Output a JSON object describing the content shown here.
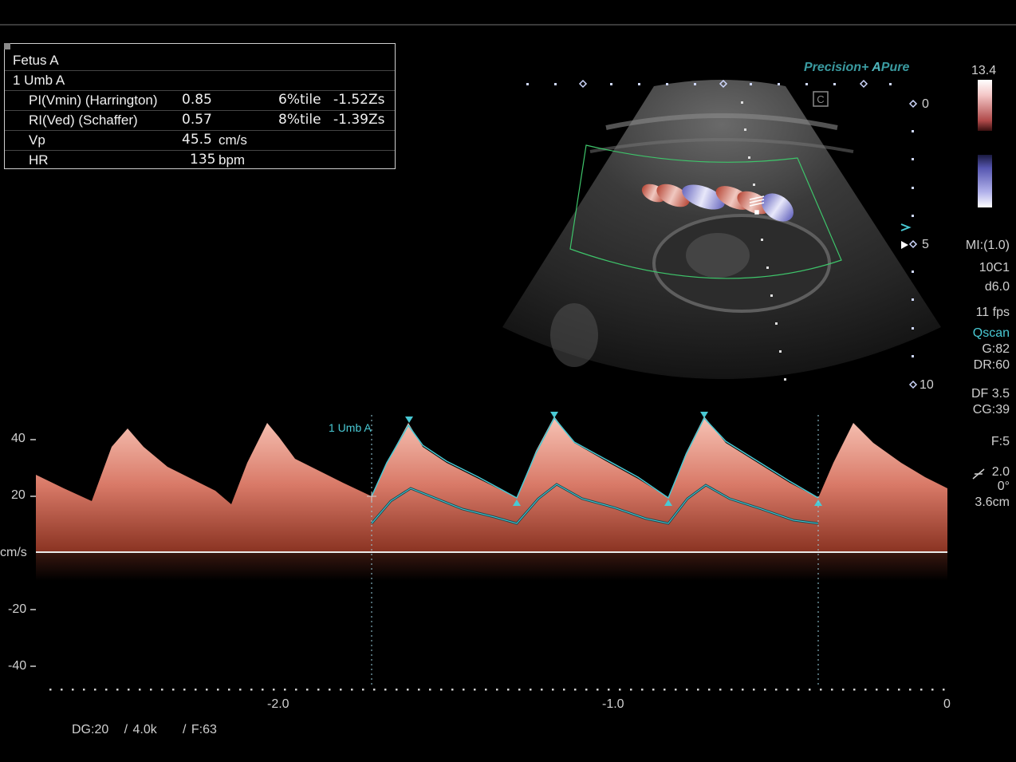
{
  "measurement_box": {
    "fetus": "Fetus A",
    "vessel": "1 Umb A",
    "rows": [
      {
        "label": "PI(Vmin) (Harrington)",
        "value": "0.85",
        "percentile": "6%tile",
        "zscore": "-1.52Zs"
      },
      {
        "label": "RI(Ved) (Schaffer)",
        "value": "0.57",
        "percentile": "8%tile",
        "zscore": "-1.39Zs"
      },
      {
        "label": "Vp",
        "value": "45.5",
        "unit": "cm/s"
      },
      {
        "label": "HR",
        "value": "135",
        "unit": "bpm"
      }
    ]
  },
  "brand": {
    "precision": "Precision+",
    "apure_a": "A",
    "apure": "Pure"
  },
  "color_scale": {
    "max": "13.4"
  },
  "depth_markers": [
    "0",
    "5",
    "10"
  ],
  "right_panel": {
    "mi": "MI:(1.0)",
    "probe": "10C1",
    "depth": "d6.0",
    "fps": "11 fps",
    "qscan": "Qscan",
    "gain": "G:82",
    "dr": "DR:60",
    "df": "DF 3.5",
    "cg": "CG:39",
    "filter": "F:5",
    "scale": "2.0",
    "angle": "0°",
    "gate": "3.6cm"
  },
  "doppler": {
    "trace_label": "1 Umb A",
    "y_unit": "cm/s",
    "y_ticks": [
      "40",
      "20",
      "-20",
      "-40"
    ],
    "x_ticks": [
      "-2.0",
      "-1.0",
      "0"
    ]
  },
  "footer": {
    "dg": "DG:20",
    "freq": "/ 4.0k",
    "f": "/ F:63"
  },
  "colors": {
    "trace": "#49c9d4",
    "spectrum": "#e89080",
    "text": "#d0d0d0"
  }
}
